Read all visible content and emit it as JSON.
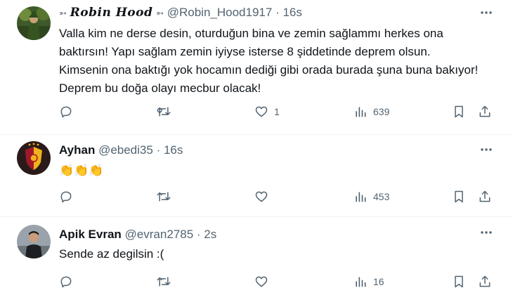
{
  "tweets": [
    {
      "name": "Robin Hood",
      "handle": "@Robin_Hood1917",
      "separator": "·",
      "time": "16s",
      "text": "Valla kim ne derse desin, oturduğun bina ve zemin sağlammı herkes ona baktırsın! Yapı sağlam zemin iyiyse isterse 8 şiddetinde deprem olsun. Kimsenin ona baktığı yok hocamın dediği gibi orada burada şuna buna bakıyor! Deprem bu doğa olayı mecbur olacak!",
      "likes": "1",
      "views": "639"
    },
    {
      "name": "Ayhan",
      "handle": "@ebedi35",
      "separator": "·",
      "time": "16s",
      "text": "👏👏👏",
      "likes": "",
      "views": "453"
    },
    {
      "name": "Apik Evran",
      "handle": "@evran2785",
      "separator": "·",
      "time": "2s",
      "text": "Sende az degilsin :(",
      "likes": "",
      "views": "16"
    }
  ],
  "icons": {
    "reply": "reply-icon",
    "retweet": "retweet-icon",
    "like": "heart-icon",
    "views": "views-icon",
    "bookmark": "bookmark-icon",
    "share": "share-icon",
    "more": "more-icon"
  },
  "colors": {
    "text": "#0f1419",
    "secondary": "#536471",
    "divider": "#eff3f4"
  }
}
